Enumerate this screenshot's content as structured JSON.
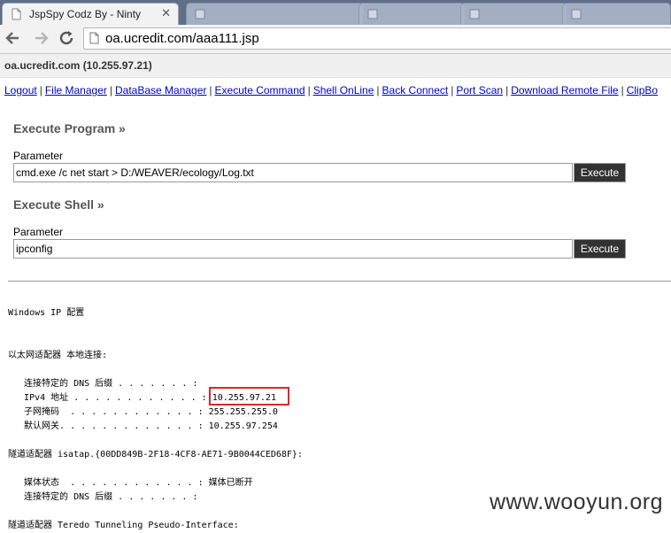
{
  "browser": {
    "active_tab_title": "JspSpy Codz By - Ninty",
    "background_tabs": [
      "",
      "",
      "",
      ""
    ],
    "url": "oa.ucredit.com/aaa111.jsp"
  },
  "page": {
    "host_line": "oa.ucredit.com (10.255.97.21)",
    "menu": [
      "Logout",
      "File Manager",
      "DataBase Manager",
      "Execute Command",
      "Shell OnLine",
      "Back Connect",
      "Port Scan",
      "Download Remote File",
      "ClipBo"
    ],
    "menu_separator": "|",
    "execute_program": {
      "heading": "Execute Program »",
      "param_label": "Parameter",
      "param_value": "cmd.exe /c net start > D:/WEAVER/ecology/Log.txt",
      "button": "Execute"
    },
    "execute_shell": {
      "heading": "Execute Shell »",
      "param_label": "Parameter",
      "param_value": "ipconfig",
      "button": "Execute"
    },
    "output": "Windows IP 配置\n\n\n以太网适配器 本地连接:\n\n   连接特定的 DNS 后缀 . . . . . . . :\n   IPv4 地址 . . . . . . . . . . . . : 10.255.97.21\n   子网掩码  . . . . . . . . . . . . : 255.255.255.0\n   默认网关. . . . . . . . . . . . . : 10.255.97.254\n\n隧道适配器 isatap.{00DD849B-2F18-4CF8-AE71-9B0044CED68F}:\n\n   媒体状态  . . . . . . . . . . . . : 媒体已断开\n   连接特定的 DNS 后缀 . . . . . . . :\n\n隧道适配器 Teredo Tunneling Pseudo-Interface:"
  },
  "watermark": "www.wooyun.org",
  "colors": {
    "link": "#0000cc",
    "highlight_box": "#e0262a",
    "exec_button_bg": "#333333"
  },
  "icons": {
    "back": "arrow-left-icon",
    "forward": "arrow-right-icon",
    "reload": "reload-icon",
    "page": "page-icon",
    "favicon": "page-favicon-icon",
    "tab_close": "close-icon"
  }
}
